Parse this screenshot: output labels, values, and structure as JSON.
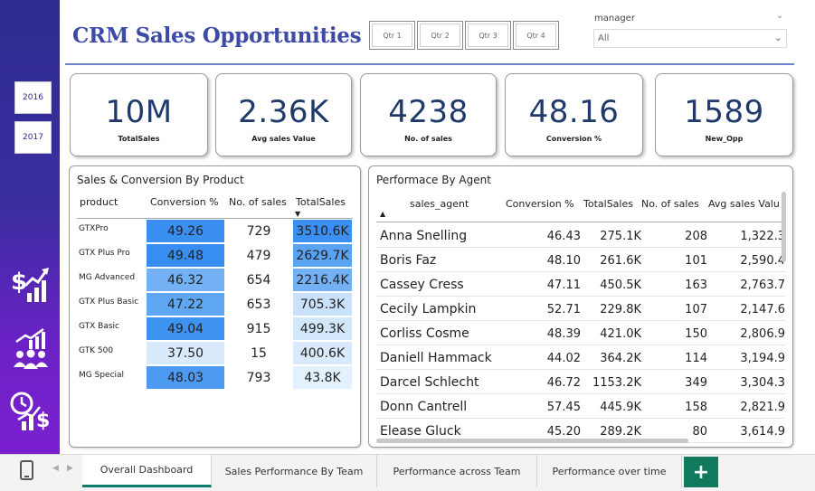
{
  "header": {
    "title": "CRM Sales Opportunities",
    "quarters": [
      "Qtr 1",
      "Qtr 2",
      "Qtr 3",
      "Qtr 4"
    ],
    "manager_label": "manager",
    "manager_value": "All"
  },
  "sidebar": {
    "years": [
      "2016",
      "2017"
    ],
    "icons": [
      "sales-growth-icon",
      "team-performance-icon",
      "time-money-icon"
    ]
  },
  "kpis": [
    {
      "value": "10M",
      "label": "TotalSales"
    },
    {
      "value": "2.36K",
      "label": "Avg sales Value"
    },
    {
      "value": "4238",
      "label": "No. of sales"
    },
    {
      "value": "48.16",
      "label": "Conversion %"
    },
    {
      "value": "1589",
      "label": "New_Opp"
    }
  ],
  "product_table": {
    "title": "Sales & Conversion By Product",
    "columns": [
      "product",
      "Conversion %",
      "No. of sales",
      "TotalSales"
    ],
    "rows": [
      {
        "product": "GTXPro",
        "conversion": "49.26",
        "sales": "729",
        "total": "3510.6K",
        "conv_color": "#3a8ff0",
        "total_color": "#3a8ff0"
      },
      {
        "product": "GTX Plus Pro",
        "conversion": "49.48",
        "sales": "479",
        "total": "2629.7K",
        "conv_color": "#378df0",
        "total_color": "#5aa2f2"
      },
      {
        "product": "MG Advanced",
        "conversion": "46.32",
        "sales": "654",
        "total": "2216.4K",
        "conv_color": "#74b1f4",
        "total_color": "#73b0f4"
      },
      {
        "product": "GTX Plus Basic",
        "conversion": "47.22",
        "sales": "653",
        "total": "705.3K",
        "conv_color": "#60a7f3",
        "total_color": "#c9e1fa"
      },
      {
        "product": "GTX Basic",
        "conversion": "49.04",
        "sales": "915",
        "total": "499.3K",
        "conv_color": "#3e92f0",
        "total_color": "#d3e7fb"
      },
      {
        "product": "GTK 500",
        "conversion": "37.50",
        "sales": "15",
        "total": "400.6K",
        "conv_color": "#d8eafc",
        "total_color": "#d8eafc"
      },
      {
        "product": "MG Special",
        "conversion": "48.03",
        "sales": "793",
        "total": "43.8K",
        "conv_color": "#4c9af1",
        "total_color": "#e3f0fd"
      }
    ]
  },
  "agent_table": {
    "title": "Performace By Agent",
    "columns": [
      "sales_agent",
      "Conversion %",
      "TotalSales",
      "No. of sales",
      "Avg sales Valu"
    ],
    "rows": [
      {
        "name": "Anna Snelling",
        "conversion": "46.43",
        "total": "275.1K",
        "sales": "208",
        "avg": "1,322.3"
      },
      {
        "name": "Boris Faz",
        "conversion": "48.10",
        "total": "261.6K",
        "sales": "101",
        "avg": "2,590.4"
      },
      {
        "name": "Cassey Cress",
        "conversion": "47.11",
        "total": "450.5K",
        "sales": "163",
        "avg": "2,763.7"
      },
      {
        "name": "Cecily Lampkin",
        "conversion": "52.71",
        "total": "229.8K",
        "sales": "107",
        "avg": "2,147.6"
      },
      {
        "name": "Corliss Cosme",
        "conversion": "48.39",
        "total": "421.0K",
        "sales": "150",
        "avg": "2,806.9"
      },
      {
        "name": "Daniell Hammack",
        "conversion": "44.02",
        "total": "364.2K",
        "sales": "114",
        "avg": "3,194.9"
      },
      {
        "name": "Darcel Schlecht",
        "conversion": "46.72",
        "total": "1153.2K",
        "sales": "349",
        "avg": "3,304.3"
      },
      {
        "name": "Donn Cantrell",
        "conversion": "57.45",
        "total": "445.9K",
        "sales": "158",
        "avg": "2,821.9"
      },
      {
        "name": "Elease Gluck",
        "conversion": "45.20",
        "total": "289.2K",
        "sales": "80",
        "avg": "3,614.9"
      }
    ]
  },
  "tabs": [
    {
      "label": "Overall Dashboard",
      "active": true
    },
    {
      "label": "Sales Performance By Team",
      "active": false
    },
    {
      "label": "Performance across Team",
      "active": false
    },
    {
      "label": "Performance over time",
      "active": false
    }
  ],
  "add_tab_label": "+"
}
